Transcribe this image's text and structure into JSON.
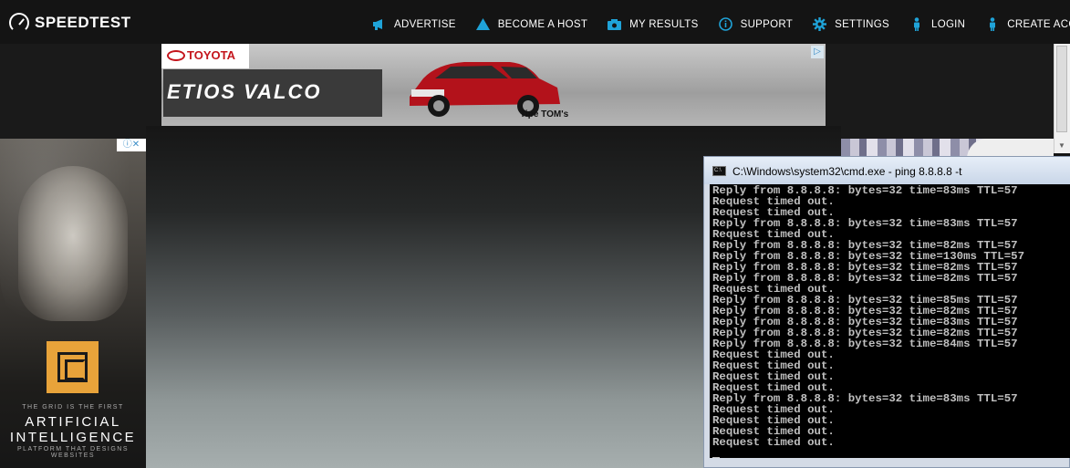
{
  "brand": {
    "name": "SPEEDTEST"
  },
  "nav": [
    {
      "label": "ADVERTISE",
      "icon": "megaphone-icon"
    },
    {
      "label": "BECOME A HOST",
      "icon": "host-triangle-icon"
    },
    {
      "label": "MY RESULTS",
      "icon": "camera-results-icon"
    },
    {
      "label": "SUPPORT",
      "icon": "info-icon"
    },
    {
      "label": "SETTINGS",
      "icon": "gear-icon"
    },
    {
      "label": "LOGIN",
      "icon": "person-icon"
    },
    {
      "label": "CREATE ACCOUNT",
      "icon": "person-add-icon"
    }
  ],
  "colors": {
    "nav_icon": "#1fa3d8",
    "background": "#141414",
    "ad_logo": "#e8a33a"
  },
  "banner_ad": {
    "brand": "TOYOTA",
    "model": "ETIOS VALCO",
    "tag": "Tipe TOM's"
  },
  "side_ad": {
    "line1": "THE GRID IS THE FIRST",
    "line2": "ARTIFICIAL",
    "line3": "INTELLIGENCE",
    "line4": "PLATFORM THAT DESIGNS WEBSITES"
  },
  "cmd": {
    "title": "C:\\Windows\\system32\\cmd.exe - ping  8.8.8.8 -t",
    "lines": [
      "Reply from 8.8.8.8: bytes=32 time=83ms TTL=57",
      "Request timed out.",
      "Request timed out.",
      "Reply from 8.8.8.8: bytes=32 time=83ms TTL=57",
      "Request timed out.",
      "Reply from 8.8.8.8: bytes=32 time=82ms TTL=57",
      "Reply from 8.8.8.8: bytes=32 time=130ms TTL=57",
      "Reply from 8.8.8.8: bytes=32 time=82ms TTL=57",
      "Reply from 8.8.8.8: bytes=32 time=82ms TTL=57",
      "Request timed out.",
      "Reply from 8.8.8.8: bytes=32 time=85ms TTL=57",
      "Reply from 8.8.8.8: bytes=32 time=82ms TTL=57",
      "Reply from 8.8.8.8: bytes=32 time=83ms TTL=57",
      "Reply from 8.8.8.8: bytes=32 time=82ms TTL=57",
      "Reply from 8.8.8.8: bytes=32 time=84ms TTL=57",
      "Request timed out.",
      "Request timed out.",
      "Request timed out.",
      "Request timed out.",
      "Reply from 8.8.8.8: bytes=32 time=83ms TTL=57",
      "Request timed out.",
      "Request timed out.",
      "Request timed out.",
      "Request timed out."
    ]
  }
}
